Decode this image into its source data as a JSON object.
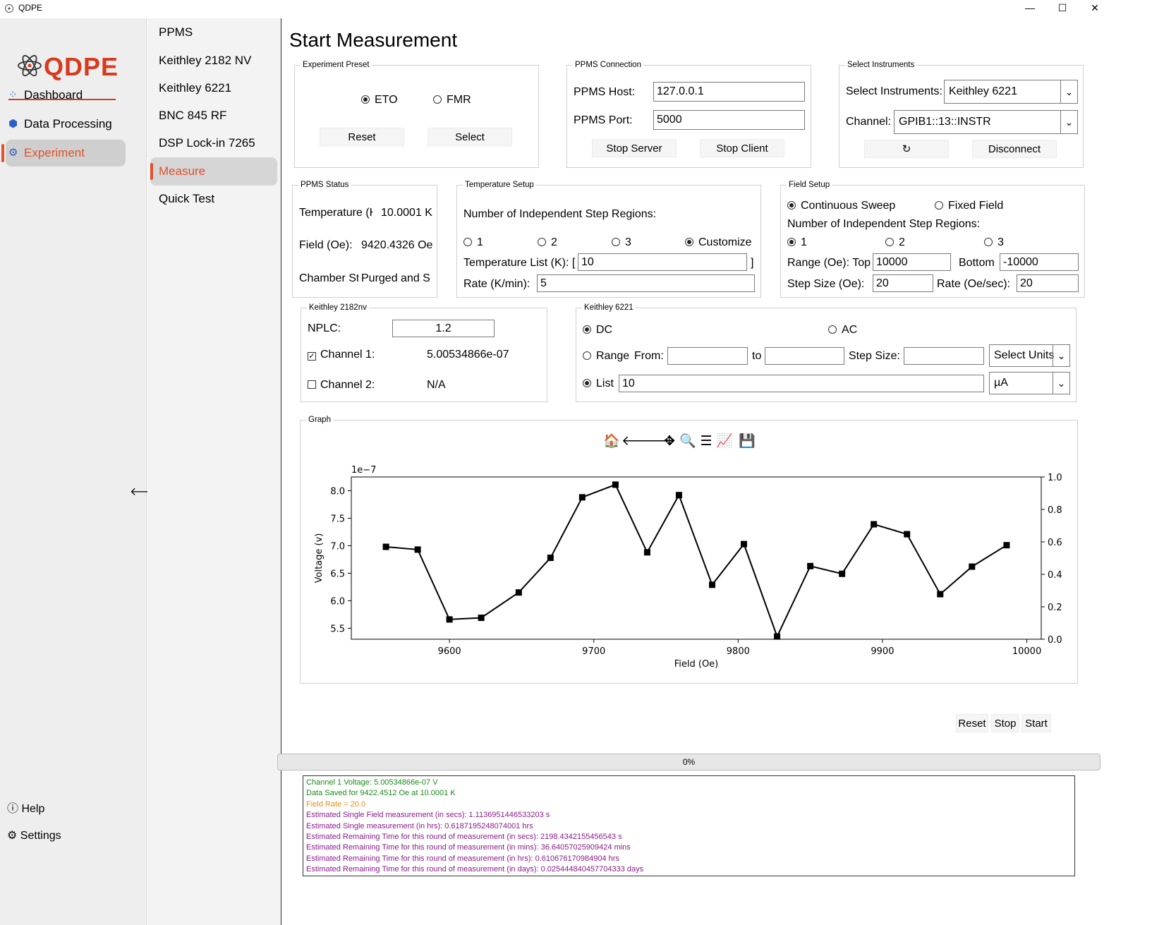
{
  "window": {
    "title": "QDPE",
    "controls": [
      "—",
      "☐",
      "✕"
    ]
  },
  "brand": {
    "text": "QDPE",
    "color": "#d83a1e"
  },
  "sidebar": {
    "items": [
      {
        "label": "Dashboard",
        "icon": "grid-icon"
      },
      {
        "label": "Data Processing",
        "icon": "cube-icon"
      },
      {
        "label": "Experiment",
        "icon": "cpu-icon",
        "active": true
      }
    ],
    "bottom": [
      {
        "label": "Help",
        "icon": "help-icon"
      },
      {
        "label": "Settings",
        "icon": "gear-icon"
      }
    ],
    "collapse_glyph": "🡐"
  },
  "subnav": {
    "items": [
      {
        "label": "PPMS"
      },
      {
        "label": "Keithley 2182 NV"
      },
      {
        "label": "Keithley 6221"
      },
      {
        "label": "BNC 845 RF"
      },
      {
        "label": "DSP Lock-in 7265"
      },
      {
        "label": "Measure",
        "active": true
      },
      {
        "label": "Quick Test"
      }
    ]
  },
  "main": {
    "title": "Start Measurement"
  },
  "preset": {
    "legend": "Experiment Preset",
    "options": [
      "ETO",
      "FMR"
    ],
    "selected": "ETO",
    "reset_label": "Reset",
    "select_label": "Select"
  },
  "ppms_conn": {
    "legend": "PPMS Connection",
    "host_label": "PPMS Host:",
    "host_value": "127.0.0.1",
    "port_label": "PPMS Port:",
    "port_value": "5000",
    "stop_server": "Stop Server",
    "stop_client": "Stop Client"
  },
  "instruments": {
    "legend": "Select Instruments",
    "label": "Select Instruments:",
    "value": "Keithley 6221",
    "channel_label": "Channel:",
    "channel_value": "GPIB1::13::INSTR",
    "refresh_glyph": "↻",
    "disconnect": "Disconnect"
  },
  "ppms_status": {
    "legend": "PPMS Status",
    "temp_label": "Temperature (K",
    "temp_value": "10.0001 K",
    "field_label": "Field (Oe):",
    "field_value": "9420.4326 Oe",
    "chamber_label": "Chamber Sta",
    "chamber_value": "Purged and S"
  },
  "temp_setup": {
    "legend": "Temperature Setup",
    "regions_label": "Number of Independent Step Regions:",
    "options": [
      "1",
      "2",
      "3",
      "Customize"
    ],
    "selected": "Customize",
    "list_label": "Temperature List (K): [",
    "list_value": "10",
    "list_close": "]",
    "rate_label": "Rate (K/min):",
    "rate_value": "5"
  },
  "field_setup": {
    "legend": "Field Setup",
    "modes": [
      "Continuous Sweep",
      "Fixed Field"
    ],
    "mode_selected": "Continuous Sweep",
    "regions_label": "Number of Independent Step Regions:",
    "options": [
      "1",
      "2",
      "3"
    ],
    "selected": "1",
    "range_label": "Range (Oe): Top",
    "top_value": "10000",
    "bottom_label": "Bottom",
    "bottom_value": "-10000",
    "step_label": "Step Size (Oe):",
    "step_value": "20",
    "rate_label": "Rate (Oe/sec):",
    "rate_value": "20"
  },
  "k2182": {
    "legend": "Keithley 2182nv",
    "nplc_label": "NPLC:",
    "nplc_value": "1.2",
    "ch1_label": "Channel 1:",
    "ch1_checked": true,
    "ch1_value": "5.00534866e-07",
    "ch2_label": "Channel 2:",
    "ch2_checked": false,
    "ch2_value": "N/A",
    "check_glyph": "✓"
  },
  "k6221": {
    "legend": "Keithley 6221",
    "dc_label": "DC",
    "ac_label": "AC",
    "mode_selected": "DC",
    "range_label": "Range",
    "from_label": "From:",
    "to_label": "to",
    "step_label": "Step Size:",
    "units_placeholder": "Select Units",
    "list_label": "List",
    "list_value": "10",
    "list_units": "µA",
    "source_selected": "List"
  },
  "graph": {
    "legend": "Graph",
    "toolbar": [
      "home-icon",
      "back-arrow-icon",
      "forward-arrow-icon",
      "pan-icon",
      "zoom-icon",
      "configure-icon",
      "edit-axis-icon",
      "save-icon"
    ],
    "toolbar_glyphs": [
      "🏠",
      "🡐",
      "🡒",
      "✥",
      "🔍",
      "☰",
      "📈",
      "💾"
    ]
  },
  "chart_data": {
    "type": "line",
    "xlabel": "Field (Oe)",
    "ylabel": "Voltage (v)",
    "y_offset_label": "1e−7",
    "xlim": [
      9532,
      10010
    ],
    "ylim": [
      5.3,
      8.25
    ],
    "xticks": [
      9600,
      9700,
      9800,
      9900,
      10000
    ],
    "yticks": [
      5.5,
      6.0,
      6.5,
      7.0,
      7.5,
      8.0
    ],
    "y2lim": [
      0.0,
      1.0
    ],
    "y2ticks": [
      0.0,
      0.2,
      0.4,
      0.6,
      0.8,
      1.0
    ],
    "marker": "square",
    "color": "#000000",
    "x": [
      9556,
      9578,
      9600,
      9622,
      9648,
      9670,
      9692,
      9715,
      9737,
      9759,
      9782,
      9804,
      9827,
      9850,
      9872,
      9894,
      9917,
      9940,
      9962,
      9986
    ],
    "y": [
      6.98,
      6.93,
      5.66,
      5.69,
      6.15,
      6.78,
      7.88,
      8.11,
      6.88,
      7.92,
      6.29,
      7.03,
      5.35,
      6.63,
      6.49,
      7.39,
      7.21,
      6.12,
      6.62,
      7.01
    ]
  },
  "actions": {
    "reset": "Reset",
    "stop": "Stop",
    "start": "Start"
  },
  "progress": {
    "text": "0%",
    "value": 0
  },
  "log": [
    {
      "text": "Channel 1 Voltage: 5.00534866e-07 V",
      "color": "green"
    },
    {
      "text": "Data Saved for 9422.4512 Oe at 10.0001 K",
      "color": "green"
    },
    {
      "text": "Field Rate = 20.0",
      "color": "orange"
    },
    {
      "text": "Estimated Single Field measurement (in secs): 1.1136951446533203 s",
      "color": "purple"
    },
    {
      "text": "Estimated Single measurement (in hrs): 0.6187195248074001 hrs",
      "color": "purple"
    },
    {
      "text": "Estimated Remaining Time for this round of measurement (in secs): 2198.4342155456543 s",
      "color": "purple"
    },
    {
      "text": "Estimated Remaining Time for this round of measurement (in mins): 36.64057025909424 mins",
      "color": "purple"
    },
    {
      "text": "Estimated Remaining Time for this round of measurement (in hrs): 0.610676170984904 hrs",
      "color": "purple"
    },
    {
      "text": "Estimated Remaining Time for this round of measurement (in days): 0.025444840457704333 days",
      "color": "purple"
    }
  ]
}
